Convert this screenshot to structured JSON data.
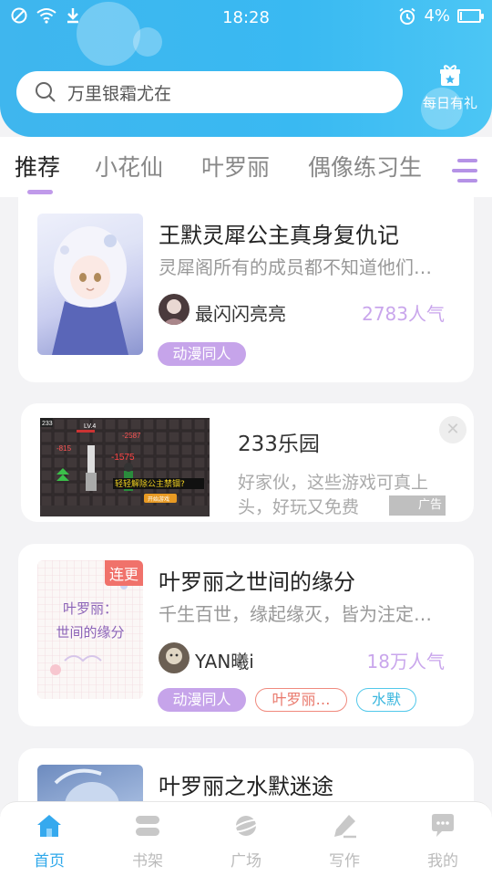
{
  "status_bar": {
    "time": "18:28",
    "battery": "4%"
  },
  "header": {
    "search_placeholder": "万里银霜尤在",
    "daily_gift": "每日有礼"
  },
  "tabs": [
    {
      "label": "推荐",
      "active": true
    },
    {
      "label": "小花仙",
      "active": false
    },
    {
      "label": "叶罗丽",
      "active": false
    },
    {
      "label": "偶像练习生",
      "active": false
    }
  ],
  "stories": [
    {
      "title": "王默灵犀公主真身复仇记",
      "desc": "灵犀阁所有的成员都不知道他们…",
      "author": "最闪闪亮亮",
      "popularity": "2783人气",
      "tags": [
        "动漫同人"
      ]
    },
    {
      "badge": "连更",
      "cover_text": [
        "叶罗丽：",
        "世间的缘分"
      ],
      "title": "叶罗丽之世间的缘分",
      "desc": "千生百世，缘起缘灭，皆为注定…",
      "author": "YAN曦i",
      "popularity": "18万人气",
      "tags": [
        "动漫同人",
        "叶罗丽…",
        "水默"
      ]
    },
    {
      "title": "叶罗丽之水默迷途"
    }
  ],
  "ad": {
    "title": "233乐园",
    "desc": "好家伙，这些游戏可真上头，好玩又免费",
    "label": "广告",
    "image_text": {
      "level": "LV.4",
      "n1": "-2587",
      "n2": "-1575",
      "n3": "-815",
      "banner": "轻轻解除公主禁锢?",
      "start": "开始游戏",
      "corner": "233"
    }
  },
  "bottom_nav": [
    {
      "label": "首页",
      "icon": "home-icon",
      "active": true
    },
    {
      "label": "书架",
      "icon": "bookshelf-icon",
      "active": false
    },
    {
      "label": "广场",
      "icon": "planet-icon",
      "active": false
    },
    {
      "label": "写作",
      "icon": "pen-icon",
      "active": false
    },
    {
      "label": "我的",
      "icon": "chat-bubble-icon",
      "active": false
    }
  ],
  "colors": {
    "header": "#3fb6ee",
    "accent_purple": "#c6a4ea",
    "active_nav": "#2fa8ea",
    "badge_red": "#f0726b"
  }
}
